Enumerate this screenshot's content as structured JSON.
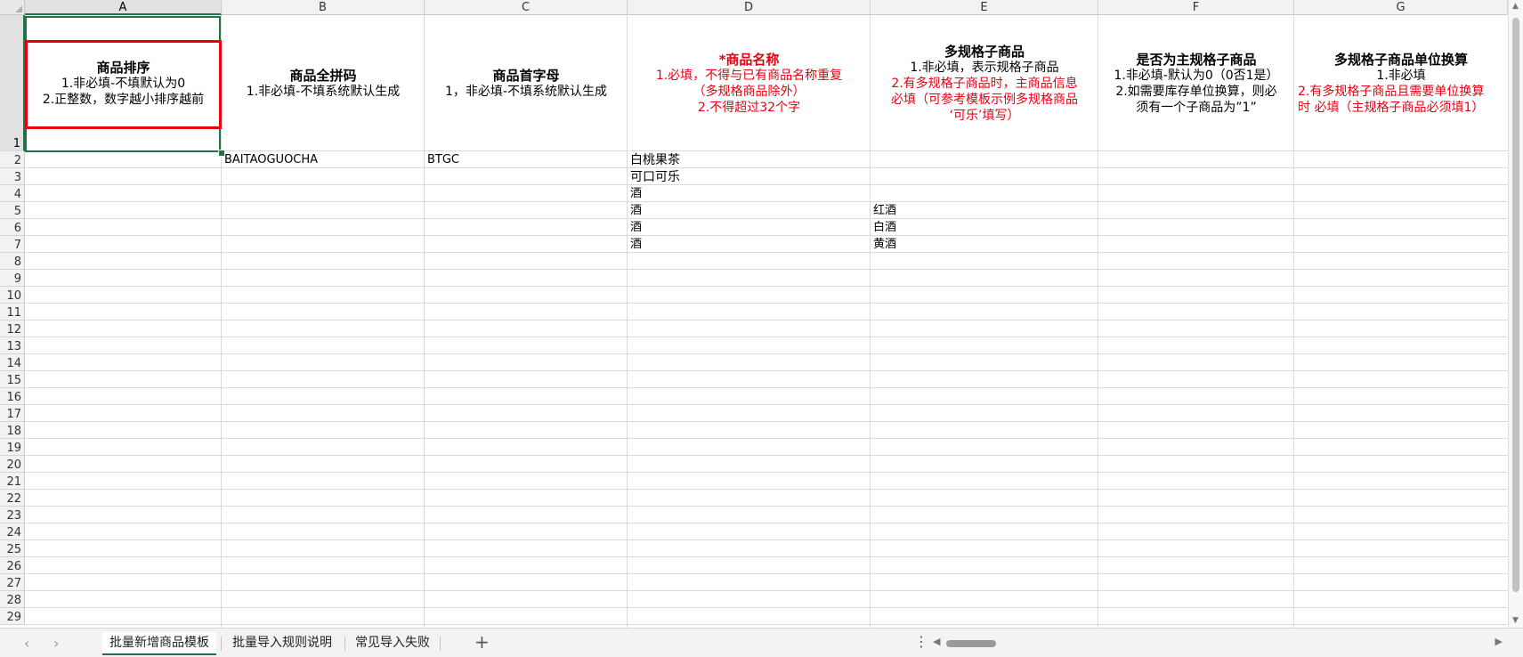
{
  "columns": [
    "A",
    "B",
    "C",
    "D",
    "E",
    "F",
    "G"
  ],
  "rows": [
    "1",
    "2",
    "3",
    "4",
    "5",
    "6",
    "7",
    "8",
    "9",
    "10",
    "11",
    "12",
    "13",
    "14",
    "15",
    "16",
    "17",
    "18",
    "19",
    "20",
    "21",
    "22",
    "23",
    "24",
    "25",
    "26",
    "27",
    "28",
    "29"
  ],
  "header_row": {
    "A": {
      "title": "商品排序",
      "line1": "1.非必填-不填默认为0",
      "line2": "2.正整数，数字越小排序越前"
    },
    "B": {
      "title": "商品全拼码",
      "line1": "1.非必填-不填系统默认生成"
    },
    "C": {
      "title": "商品首字母",
      "line1": "1，非必填-不填系统默认生成"
    },
    "D": {
      "title": "*商品名称",
      "line1": "1.必填，不得与已有商品名称重复",
      "line2": "（多规格商品除外）",
      "line3": "2.不得超过32个字"
    },
    "E": {
      "title": "多规格子商品",
      "line1": "1.非必填，表示规格子商品",
      "line2": "2.有多规格子商品时，主商品信息",
      "line3": "必填（可参考模板示例多规格商品",
      "line4": "‘可乐’填写）"
    },
    "F": {
      "title": "是否为主规格子商品",
      "line1": "1.非必填-默认为0（0否1是）",
      "line2": "2.如需要库存单位换算，则必",
      "line3": "须有一个子商品为”1”"
    },
    "G": {
      "title": "多规格子商品单位换算",
      "line1": "1.非必填",
      "line2": "2.有多规格子商品且需要单位换算",
      "line3": "时 必填（主规格子商品必须填1）"
    }
  },
  "data_rows": {
    "r2": {
      "B": "BAITAOGUOCHA",
      "C": "BTGC",
      "D": "白桃果茶"
    },
    "r3": {
      "D": "可口可乐"
    },
    "r4": {
      "D": "酒"
    },
    "r5": {
      "D": "酒",
      "E": "红酒"
    },
    "r6": {
      "D": "酒",
      "E": "白酒"
    },
    "r7": {
      "D": "酒",
      "E": "黄酒"
    }
  },
  "sheet_tabs": [
    "批量新增商品模板",
    "批量导入规则说明",
    "常见导入失败"
  ],
  "active_tab": "批量新增商品模板",
  "icons": {
    "add_sheet": "+",
    "more": "⋮",
    "prev": "‹",
    "next": "›"
  },
  "colors": {
    "accent": "#217346",
    "required_red": "#e60012",
    "highlight_box": "#e60012"
  }
}
